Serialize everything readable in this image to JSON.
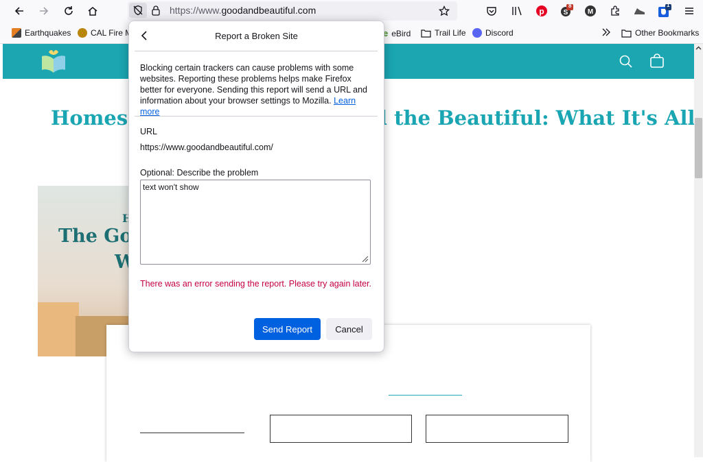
{
  "toolbar": {
    "url_prefix": "https://www.",
    "url_domain": "goodandbeautiful.com",
    "extension_badges": {
      "pinterest_count": "8",
      "bitwarden_count": "1"
    }
  },
  "bookmarks": {
    "items": [
      {
        "label": "Earthquakes"
      },
      {
        "label": "CAL Fire M"
      },
      {
        "label": "eBird"
      },
      {
        "label": "Trail Life"
      },
      {
        "label": "Discord"
      }
    ],
    "other": "Other Bookmarks"
  },
  "page": {
    "heading_left": "Homescl",
    "heading_right": "l the Beautiful: What It's All",
    "hero_line1": "The Goo",
    "hero_line2": "W",
    "hero_small": "H"
  },
  "panel": {
    "title": "Report a Broken Site",
    "description": "Blocking certain trackers can cause problems with some websites. Reporting these problems helps make Firefox better for everyone. Sending this report will send a URL and information about your browser settings to Mozilla.",
    "learn_more": "Learn more",
    "url_label": "URL",
    "url_value": "https://www.goodandbeautiful.com/",
    "describe_label": "Optional: Describe the problem",
    "describe_value": "text won't show",
    "error": "There was an error sending the report. Please try again later.",
    "send_label": "Send Report",
    "cancel_label": "Cancel"
  },
  "colors": {
    "brand_teal": "#1ba6b2",
    "primary_blue": "#0061e0",
    "error_red": "#c50042"
  }
}
